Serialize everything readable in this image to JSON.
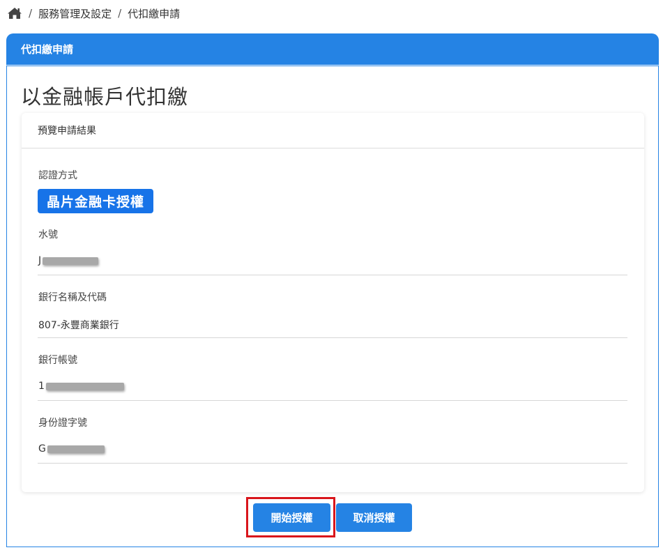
{
  "breadcrumb": {
    "items": [
      "服務管理及設定",
      "代扣繳申請"
    ],
    "separator": "/"
  },
  "panel": {
    "header_title": "代扣繳申請",
    "page_title": "以金融帳戶代扣繳"
  },
  "card": {
    "header": "預覽申請結果",
    "fields": [
      {
        "label": "認證方式",
        "value": "晶片金融卡授權"
      },
      {
        "label": "水號",
        "value": "J"
      },
      {
        "label": "銀行名稱及代碼",
        "value": "807-永豐商業銀行"
      },
      {
        "label": "銀行帳號",
        "value": "1"
      },
      {
        "label": "身份證字號",
        "value": "G"
      }
    ]
  },
  "buttons": {
    "start_label": "開始授權",
    "cancel_label": "取消授權"
  },
  "colors": {
    "primary": "#2583e4",
    "badge": "#1773e8",
    "highlight": "#d9161c"
  }
}
